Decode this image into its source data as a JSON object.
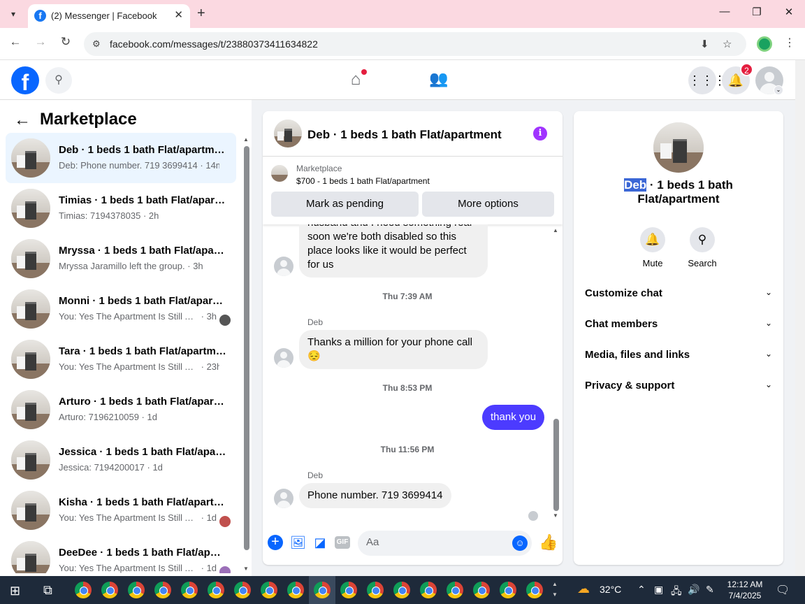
{
  "browser": {
    "tab_title": "(2) Messenger | Facebook",
    "url": "facebook.com/messages/t/23880373411634822"
  },
  "fb": {
    "notification_count": "2"
  },
  "sidebar": {
    "title": "Marketplace",
    "conversations": [
      {
        "name": "Deb · 1 beds 1 bath Flat/apartment",
        "snippet": "Deb: Phone number. 719 3699414",
        "time": "14m",
        "active": true
      },
      {
        "name": "Timias · 1 beds 1 bath Flat/apartment",
        "snippet": "Timias: 7194378035",
        "time": "2h"
      },
      {
        "name": "Mryssa · 1 beds 1 bath Flat/apartment",
        "snippet": "Mryssa Jaramillo left the group.",
        "time": "3h"
      },
      {
        "name": "Monni · 1 beds 1 bath Flat/apartment",
        "snippet": "You: Yes The Apartment Is Still Available",
        "time": "3h"
      },
      {
        "name": "Tara · 1 beds 1 bath Flat/apartment",
        "snippet": "You: Yes The Apartment Is Still Available",
        "time": "23h"
      },
      {
        "name": "Arturo · 1 beds 1 bath Flat/apartment",
        "snippet": "Arturo: 7196210059",
        "time": "1d"
      },
      {
        "name": "Jessica · 1 beds 1 bath Flat/apartment",
        "snippet": "Jessica: 7194200017",
        "time": "1d"
      },
      {
        "name": "Kisha · 1 beds 1 bath Flat/apartment",
        "snippet": "You: Yes The Apartment Is Still Available",
        "time": "1d"
      },
      {
        "name": "DeeDee · 1 beds 1 bath Flat/apartment",
        "snippet": "You: Yes The Apartment Is Still Available",
        "time": "1d"
      }
    ]
  },
  "chat": {
    "title": "Deb · 1 beds 1 bath Flat/apartment",
    "listing_source": "Marketplace",
    "listing_title": "$700 - 1 beds 1 bath Flat/apartment",
    "mark_pending_label": "Mark as pending",
    "more_options_label": "More options",
    "first_message": "husband and I need something real soon we're both disabled so this place looks like it would be perfect for us",
    "ts1": "Thu 7:39 AM",
    "sender1": "Deb",
    "message2": "Thanks a million for your phone call 😔",
    "ts2": "Thu 8:53 PM",
    "my_message": "thank you",
    "ts3": "Thu 11:56 PM",
    "sender2": "Deb",
    "message3": "Phone number. 719 3699414",
    "composer_placeholder": "Aa",
    "accent_color": "#4c3bff"
  },
  "info": {
    "name_highlight": "Deb",
    "title_rest": " · 1 beds 1 bath Flat/apartment",
    "mute_label": "Mute",
    "search_label": "Search",
    "sections": [
      "Customize chat",
      "Chat members",
      "Media, files and links",
      "Privacy & support"
    ]
  },
  "taskbar": {
    "temperature": "32°C",
    "time": "12:12 AM",
    "date": "7/4/2025"
  }
}
